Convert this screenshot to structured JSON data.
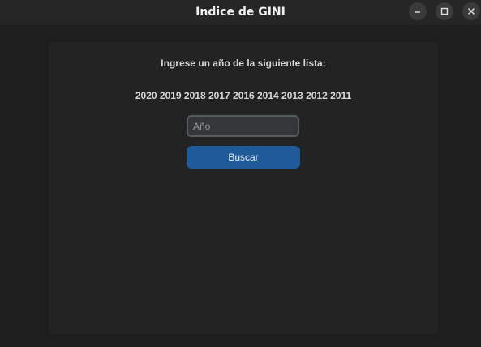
{
  "window": {
    "title": "Indice de GINI",
    "controls": {
      "minimize_icon": "minimize-icon",
      "maximize_icon": "maximize-icon",
      "close_icon": "close-icon"
    }
  },
  "form": {
    "prompt": "Ingrese un año de la siguiente lista:",
    "years_list": "2020 2019 2018 2017 2016 2014 2013 2012 2011",
    "year_input": {
      "placeholder": "Año",
      "value": ""
    },
    "search_label": "Buscar"
  },
  "colors": {
    "background": "#1e1e1e",
    "panel": "#232323",
    "accent": "#1f5a9a",
    "input_border": "#565b5e"
  }
}
